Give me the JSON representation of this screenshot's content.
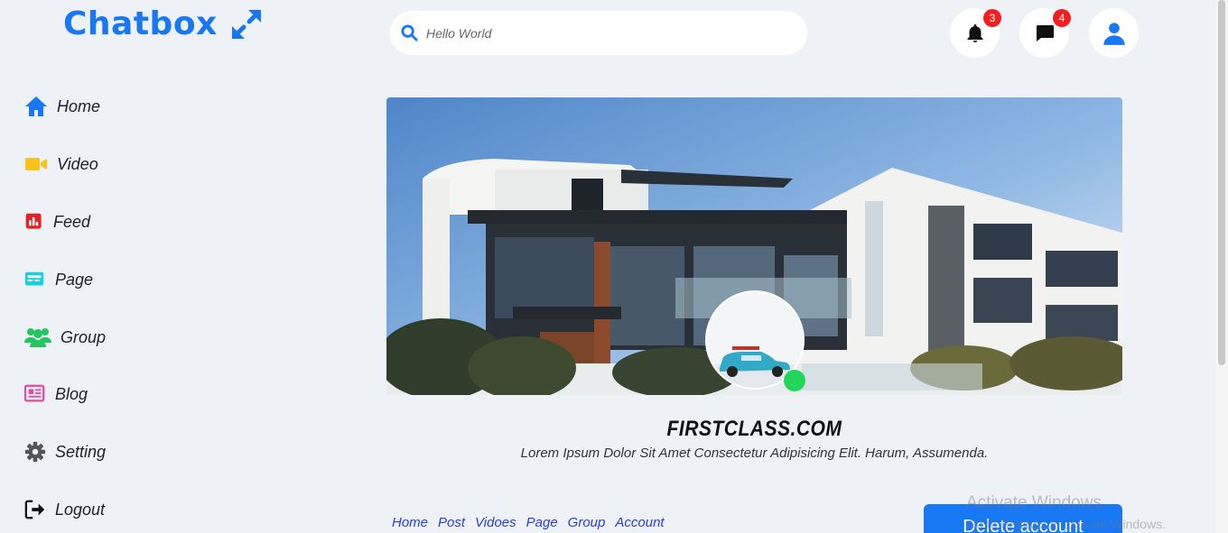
{
  "app": {
    "logo_text": "Chatbox"
  },
  "search": {
    "placeholder": "Hello World"
  },
  "header": {
    "notifications": {
      "icon": "bell-icon",
      "count": "3"
    },
    "messages": {
      "icon": "message-icon",
      "count": "4"
    },
    "profile": {
      "icon": "user-icon"
    }
  },
  "sidebar": {
    "items": [
      {
        "label": "Home",
        "icon": "home-icon",
        "color": "#1877f2"
      },
      {
        "label": "Video",
        "icon": "video-icon",
        "color": "#f7c31a"
      },
      {
        "label": "Feed",
        "icon": "feed-icon",
        "color": "#e02424"
      },
      {
        "label": "Page",
        "icon": "page-icon",
        "color": "#1ad0e0"
      },
      {
        "label": "Group",
        "icon": "group-icon",
        "color": "#22c55e"
      },
      {
        "label": "Blog",
        "icon": "blog-icon",
        "color": "#ec4899"
      },
      {
        "label": "Setting",
        "icon": "gear-icon",
        "color": "#555555"
      },
      {
        "label": "Logout",
        "icon": "logout-icon",
        "color": "#111111"
      }
    ]
  },
  "profile": {
    "name": "FIRSTCLASS.COM",
    "description": "Lorem Ipsum Dolor Sit Amet Consectetur Adipisicing Elit. Harum, Assumenda."
  },
  "tabs": [
    "Home",
    "Post",
    "Vidoes",
    "Page",
    "Group",
    "Account"
  ],
  "actions": {
    "delete_label": "Delete account"
  },
  "watermark": {
    "title": "Activate Windows",
    "subtitle": "Go to Settings to activate Windows."
  },
  "colors": {
    "brand": "#1877f2",
    "background": "#eef1f6",
    "online": "#22d65a",
    "badge": "#f02020"
  }
}
